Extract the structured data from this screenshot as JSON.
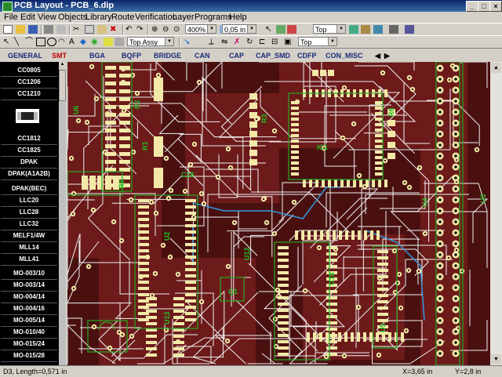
{
  "window": {
    "title": "PCB Layout - PCB_6.dip"
  },
  "menu": [
    "File",
    "Edit",
    "View",
    "Objects",
    "Library",
    "Route",
    "Verification",
    "Layer",
    "Programs",
    "Help"
  ],
  "toolbar1": {
    "zoom": "400%",
    "grid": "0,05 in",
    "layer": "Top"
  },
  "toolbar2": {
    "assembly": "Top Assy",
    "layer": "Top"
  },
  "tabs": [
    "GENERAL",
    "SMT",
    "BGA",
    "BQFP",
    "BRIDGE",
    "CAN",
    "CAP",
    "CAP_SMD",
    "CDFP",
    "CON_MISC"
  ],
  "library": [
    "CC0805",
    "CC1206",
    "CC1210",
    "CC1812",
    "CC1825",
    "DPAK",
    "DPAK(A1A2B)",
    "DPAK(BEC)",
    "LLC20",
    "LLC28",
    "LLC32",
    "MELF1/4W",
    "MLL14",
    "MLL41",
    "MO-003/10",
    "MO-003/14",
    "MO-004/14",
    "MO-004/16",
    "MO-005/14",
    "MO-010/40",
    "MO-015/24",
    "MO-015/28"
  ],
  "board_labels": {
    "u6": "U6",
    "r2": "R2",
    "ic1": "IC1",
    "c28": "C28",
    "r9": "R9",
    "u12": "U12",
    "u18": "U18",
    "u3": "U3",
    "r6": "R6",
    "u2": "U2",
    "r1": "R1",
    "r3": "R3",
    "q1": "Q1",
    "u4": "U4",
    "u13": "U13",
    "u5": "U5"
  },
  "status": {
    "left": "D3, Length=0,571 in",
    "x": "X=3,65 in",
    "y": "Y=2,8 in"
  },
  "colors": {
    "board": "#4a1010",
    "copper": "#8a2222",
    "pad": "#f2e9a8",
    "trace": "#f0f0f0",
    "silk": "#22aa22",
    "highlight": "#3399dd"
  }
}
